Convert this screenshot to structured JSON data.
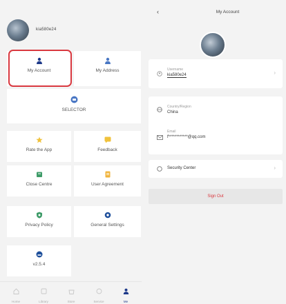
{
  "left": {
    "username": "kia580e24",
    "tiles": {
      "my_account": "My Account",
      "my_address": "My Address",
      "wide": "SELECTOR"
    },
    "grid": [
      {
        "label": "Rate the App",
        "color": "#f0c23c",
        "icon": "star-icon"
      },
      {
        "label": "Feedback",
        "color": "#f0c23c",
        "icon": "chat-icon"
      },
      {
        "label": "Close Centre",
        "color": "#3e9b68",
        "icon": "box-icon"
      },
      {
        "label": "User Agreement",
        "color": "#f0b43c",
        "icon": "document-icon"
      },
      {
        "label": "Privacy Policy",
        "color": "#3e9b68",
        "icon": "shield-icon"
      },
      {
        "label": "General Settings",
        "color": "#1e4f9b",
        "icon": "gear-icon"
      },
      {
        "label": "v2.5.4",
        "color": "#1e4f9b",
        "icon": "info-icon"
      }
    ],
    "tabs": [
      {
        "label": "Home",
        "icon": "home-icon"
      },
      {
        "label": "Library",
        "icon": "library-icon"
      },
      {
        "label": "Store",
        "icon": "store-icon"
      },
      {
        "label": "Service",
        "icon": "service-icon"
      },
      {
        "label": "Me",
        "icon": "person-icon"
      }
    ]
  },
  "right": {
    "title": "My Account",
    "back": "‹",
    "nickname": {
      "label": "Username",
      "value": "kia580e24"
    },
    "region": {
      "label": "Country/Region",
      "value": "China"
    },
    "email": {
      "label": "Email",
      "value": "f************@qq.com"
    },
    "security": {
      "label": "Security Center"
    },
    "sign_out": "Sign Out"
  },
  "colors": {
    "highlight": "#d9383f",
    "accent_blue": "#1e3a8a",
    "background": "#f3f3f3"
  }
}
